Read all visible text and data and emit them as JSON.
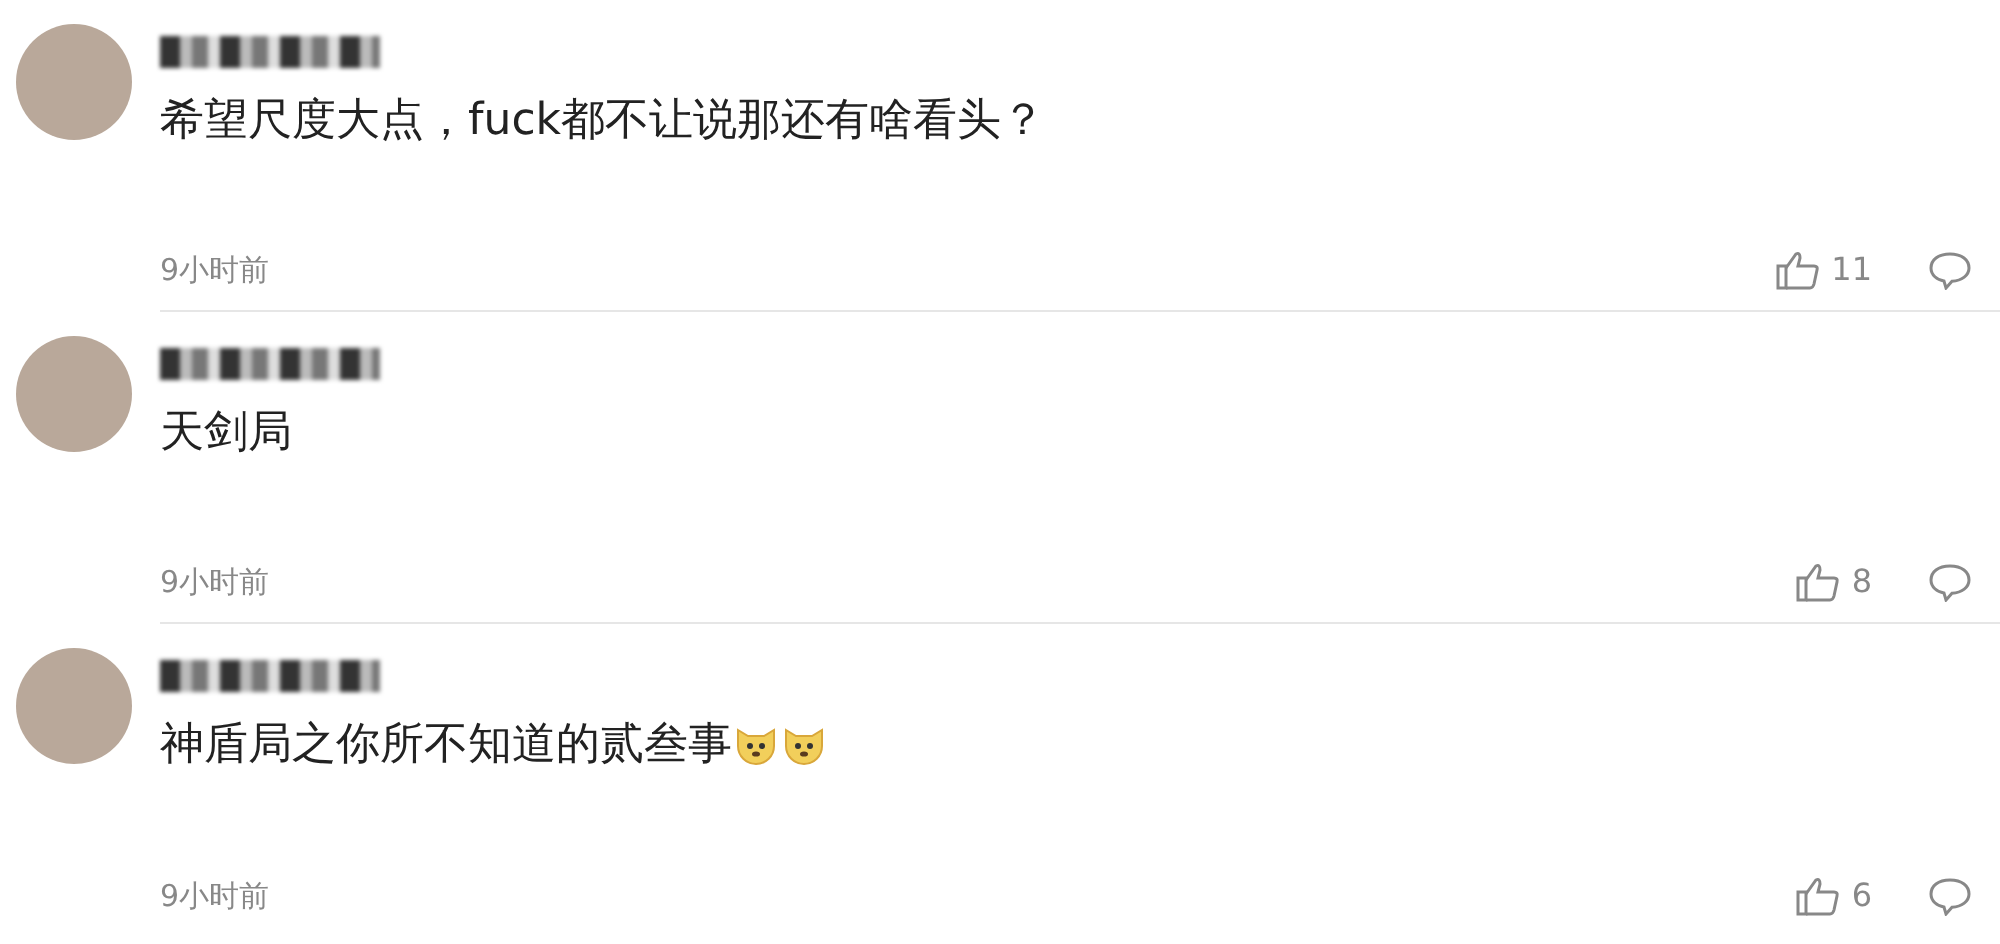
{
  "comments": [
    {
      "text": "希望尺度大点，fuck都不让说那还有啥看头？",
      "time": "9小时前",
      "likes": "11"
    },
    {
      "text": "天剑局",
      "time": "9小时前",
      "likes": "8"
    },
    {
      "text": "神盾局之你所不知道的贰叁事",
      "emojis": [
        {
          "kind": "doge"
        },
        {
          "kind": "doge"
        }
      ],
      "time": "9小时前",
      "likes": "6"
    }
  ]
}
